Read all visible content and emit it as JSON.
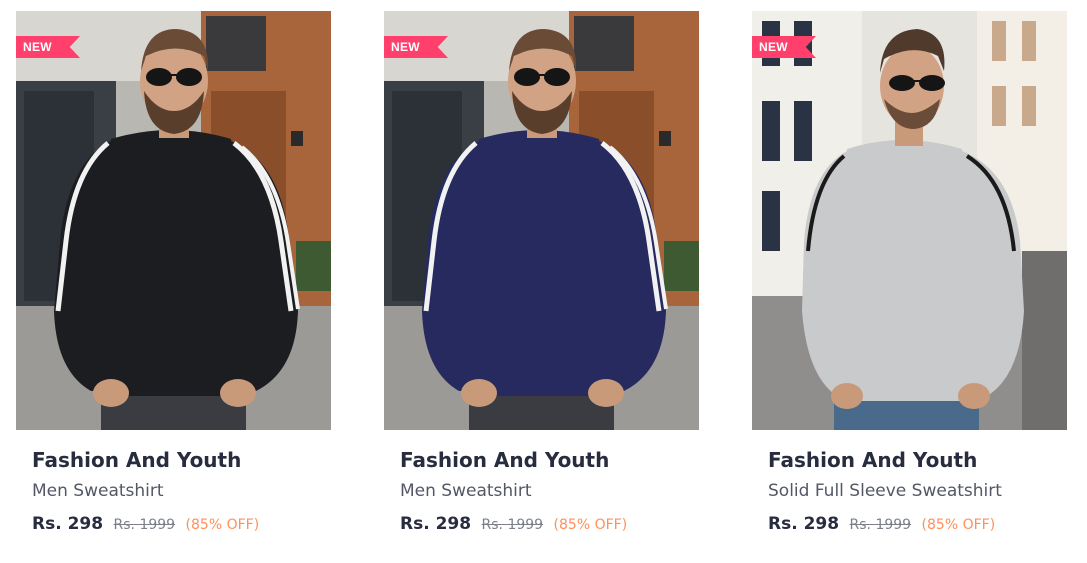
{
  "products": [
    {
      "badge": "NEW",
      "brand": "Fashion And Youth",
      "name": "Men Sweatshirt",
      "price": "Rs. 298",
      "mrp": "Rs. 1999",
      "discount": "(85% OFF)",
      "sweatshirt_color": "#1c1d20",
      "stripe_color": "#f2f2f2",
      "background": "street-with-wooden-door"
    },
    {
      "badge": "NEW",
      "brand": "Fashion And Youth",
      "name": "Men Sweatshirt",
      "price": "Rs. 298",
      "mrp": "Rs. 1999",
      "discount": "(85% OFF)",
      "sweatshirt_color": "#262a5e",
      "stripe_color": "#f2f2f2",
      "background": "street-with-wooden-door"
    },
    {
      "badge": "NEW",
      "brand": "Fashion And Youth",
      "name": "Solid Full Sleeve Sweatshirt",
      "price": "Rs. 298",
      "mrp": "Rs. 1999",
      "discount": "(85% OFF)",
      "sweatshirt_color": "#c9cacb",
      "stripe_color": "#1a1a1a",
      "background": "street-with-white-buildings"
    }
  ],
  "colors": {
    "badge_pink": "#ff3f6c",
    "brand_text": "#282c3f",
    "name_text": "#535766",
    "mrp_text": "#7e818c",
    "discount_orange": "#ff905a"
  }
}
